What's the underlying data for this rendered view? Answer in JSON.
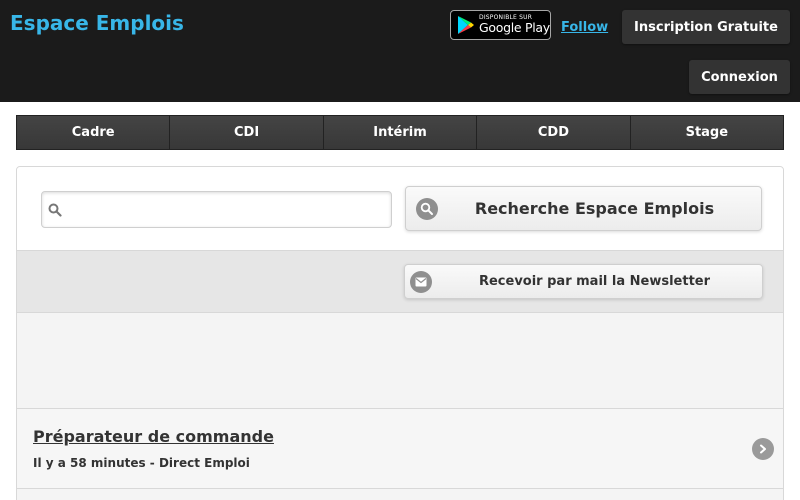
{
  "header": {
    "site_title": "Espace Emplois",
    "google_play": {
      "small_text": "DISPONIBLE SUR",
      "big_text": "Google Play"
    },
    "follow_label": "Follow",
    "signup_label": "Inscription Gratuite",
    "login_label": "Connexion"
  },
  "navbar": {
    "items": [
      {
        "label": "Cadre"
      },
      {
        "label": "CDI"
      },
      {
        "label": "Intérim"
      },
      {
        "label": "CDD"
      },
      {
        "label": "Stage"
      }
    ]
  },
  "search": {
    "input_value": "",
    "placeholder": "",
    "button_label": "Recherche Espace Emplois",
    "button_icon": "search-icon"
  },
  "newsletter": {
    "button_label": "Recevoir par mail la Newsletter",
    "button_icon": "mail-icon"
  },
  "jobs": [
    {
      "title": "Préparateur de commande",
      "meta": "Il y a 58 minutes - Direct Emploi",
      "icon": "chevron-right-icon"
    }
  ],
  "colors": {
    "header_bg": "#1b1b1b",
    "accent": "#38b6e8",
    "navbar_bg": "#3c3c3c",
    "panel_bg": "#f4f4f4"
  }
}
